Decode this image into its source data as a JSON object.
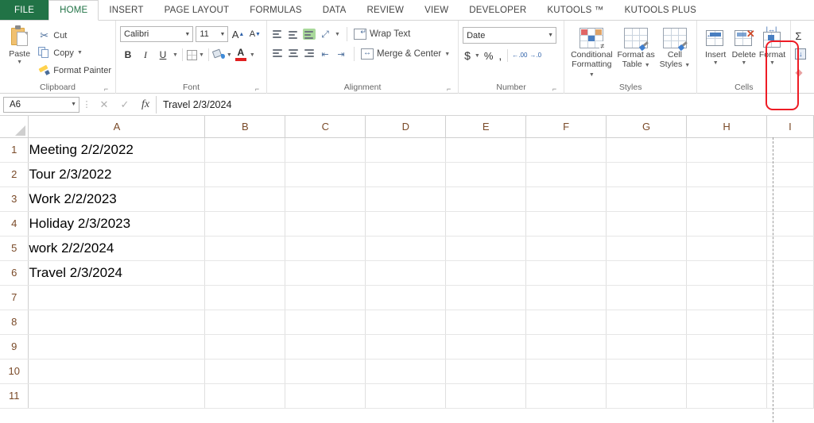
{
  "ribbon": {
    "tabs": [
      {
        "label": "FILE",
        "kind": "file"
      },
      {
        "label": "HOME",
        "kind": "active"
      },
      {
        "label": "INSERT",
        "kind": "normal"
      },
      {
        "label": "PAGE LAYOUT",
        "kind": "normal"
      },
      {
        "label": "FORMULAS",
        "kind": "normal"
      },
      {
        "label": "DATA",
        "kind": "normal"
      },
      {
        "label": "REVIEW",
        "kind": "normal"
      },
      {
        "label": "VIEW",
        "kind": "normal"
      },
      {
        "label": "DEVELOPER",
        "kind": "normal"
      },
      {
        "label": "KUTOOLS ™",
        "kind": "normal"
      },
      {
        "label": "KUTOOLS PLUS",
        "kind": "normal"
      }
    ],
    "clipboard": {
      "group_label": "Clipboard",
      "paste_label": "Paste",
      "cut_label": "Cut",
      "copy_label": "Copy",
      "format_painter_label": "Format Painter"
    },
    "font": {
      "group_label": "Font",
      "font_name": "Calibri",
      "font_size": "11",
      "grow_font_label": "A",
      "shrink_font_label": "A",
      "bold_label": "B",
      "italic_label": "I",
      "underline_label": "U",
      "font_color_label": "A"
    },
    "alignment": {
      "group_label": "Alignment",
      "wrap_text_label": "Wrap Text",
      "merge_center_label": "Merge & Center"
    },
    "number": {
      "group_label": "Number",
      "format_value": "Date",
      "currency_label": "$",
      "percent_label": "%",
      "comma_label": ",",
      "increase_decimal_label": ".00",
      "decrease_decimal_label": ".0"
    },
    "styles": {
      "group_label": "Styles",
      "conditional_formatting_label": "Conditional\nFormatting",
      "conditional_formatting_line1": "Conditional",
      "conditional_formatting_line2": "Formatting",
      "format_as_table_line1": "Format as",
      "format_as_table_line2": "Table",
      "cell_styles_line1": "Cell",
      "cell_styles_line2": "Styles"
    },
    "cells": {
      "group_label": "Cells",
      "insert_label": "Insert",
      "delete_label": "Delete",
      "format_label": "Format",
      "highlight_color": "#ee1c25"
    },
    "editing": {
      "autosum_label": "Σ",
      "fill_label": "↓",
      "clear_label": "◆"
    }
  },
  "formula_bar": {
    "name_box_value": "A6",
    "cancel_label": "✕",
    "confirm_label": "✓",
    "function_label": "fx",
    "formula_value": "Travel 2/3/2024"
  },
  "sheet": {
    "columns": [
      "A",
      "B",
      "C",
      "D",
      "E",
      "F",
      "G",
      "H",
      "I"
    ],
    "rows": [
      {
        "number": "1",
        "a": "Meeting 2/2/2022"
      },
      {
        "number": "2",
        "a": "Tour 2/3/2022"
      },
      {
        "number": "3",
        "a": "Work 2/2/2023"
      },
      {
        "number": "4",
        "a": "Holiday 2/3/2023"
      },
      {
        "number": "5",
        "a": "work 2/2/2024"
      },
      {
        "number": "6",
        "a": "Travel 2/3/2024"
      },
      {
        "number": "7",
        "a": ""
      },
      {
        "number": "8",
        "a": ""
      },
      {
        "number": "9",
        "a": ""
      },
      {
        "number": "10",
        "a": ""
      },
      {
        "number": "11",
        "a": ""
      }
    ],
    "selected_cell": "A6"
  }
}
